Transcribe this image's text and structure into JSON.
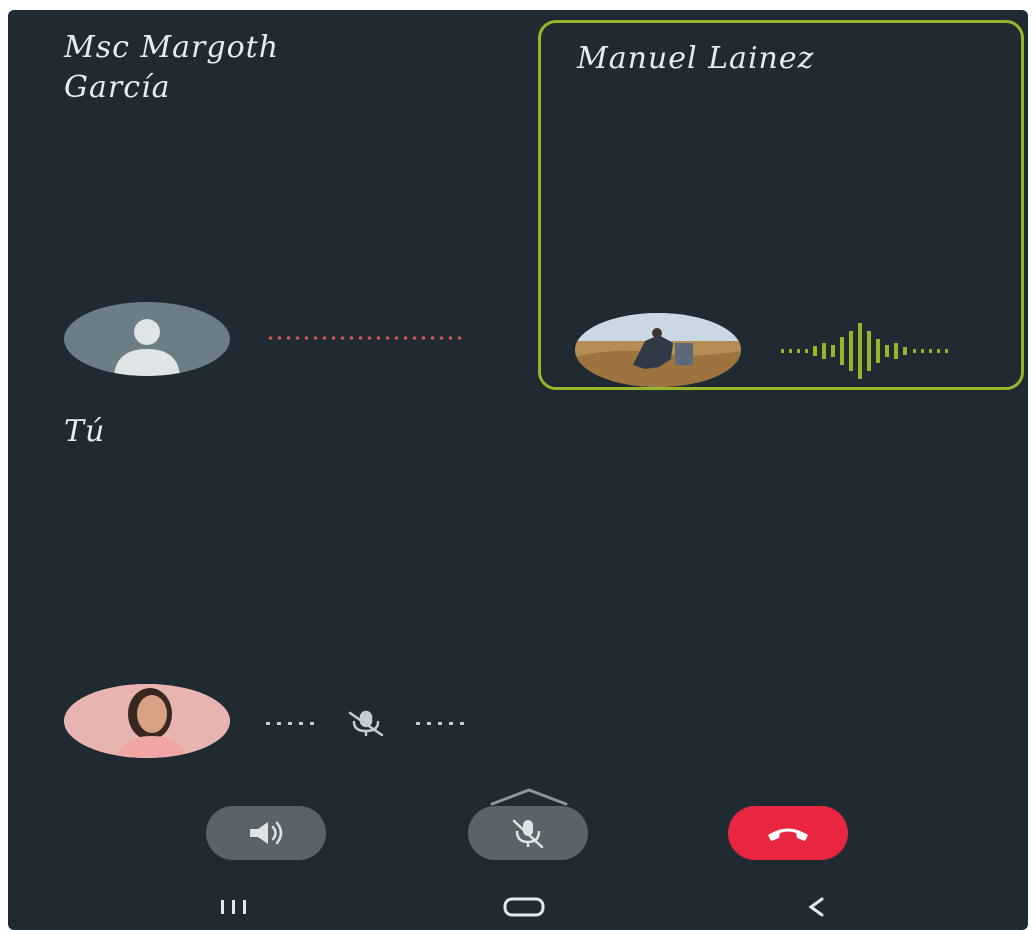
{
  "participants": [
    {
      "name": "Msc Margoth García",
      "name_line1": "Msc Margoth",
      "name_line2": "García",
      "avatar": "person-placeholder-icon",
      "state": "idle"
    },
    {
      "name": "Manuel Lainez",
      "avatar": "photo",
      "state": "speaking",
      "highlight_color": "#9bb52a"
    }
  ],
  "self": {
    "label": "Tú",
    "avatar": "photo",
    "state": "muted"
  },
  "controls": {
    "speaker": {
      "icon": "speaker-icon"
    },
    "mute": {
      "icon": "mic-off-icon"
    },
    "end_call": {
      "icon": "phone-hangup-icon",
      "color": "#e8263f"
    }
  },
  "nav": {
    "recents": "recents-icon",
    "home": "home-icon",
    "back": "back-icon"
  },
  "colors": {
    "background": "#1f2a33",
    "speaking": "#9bb52a",
    "idle_line": "#d0584f"
  }
}
